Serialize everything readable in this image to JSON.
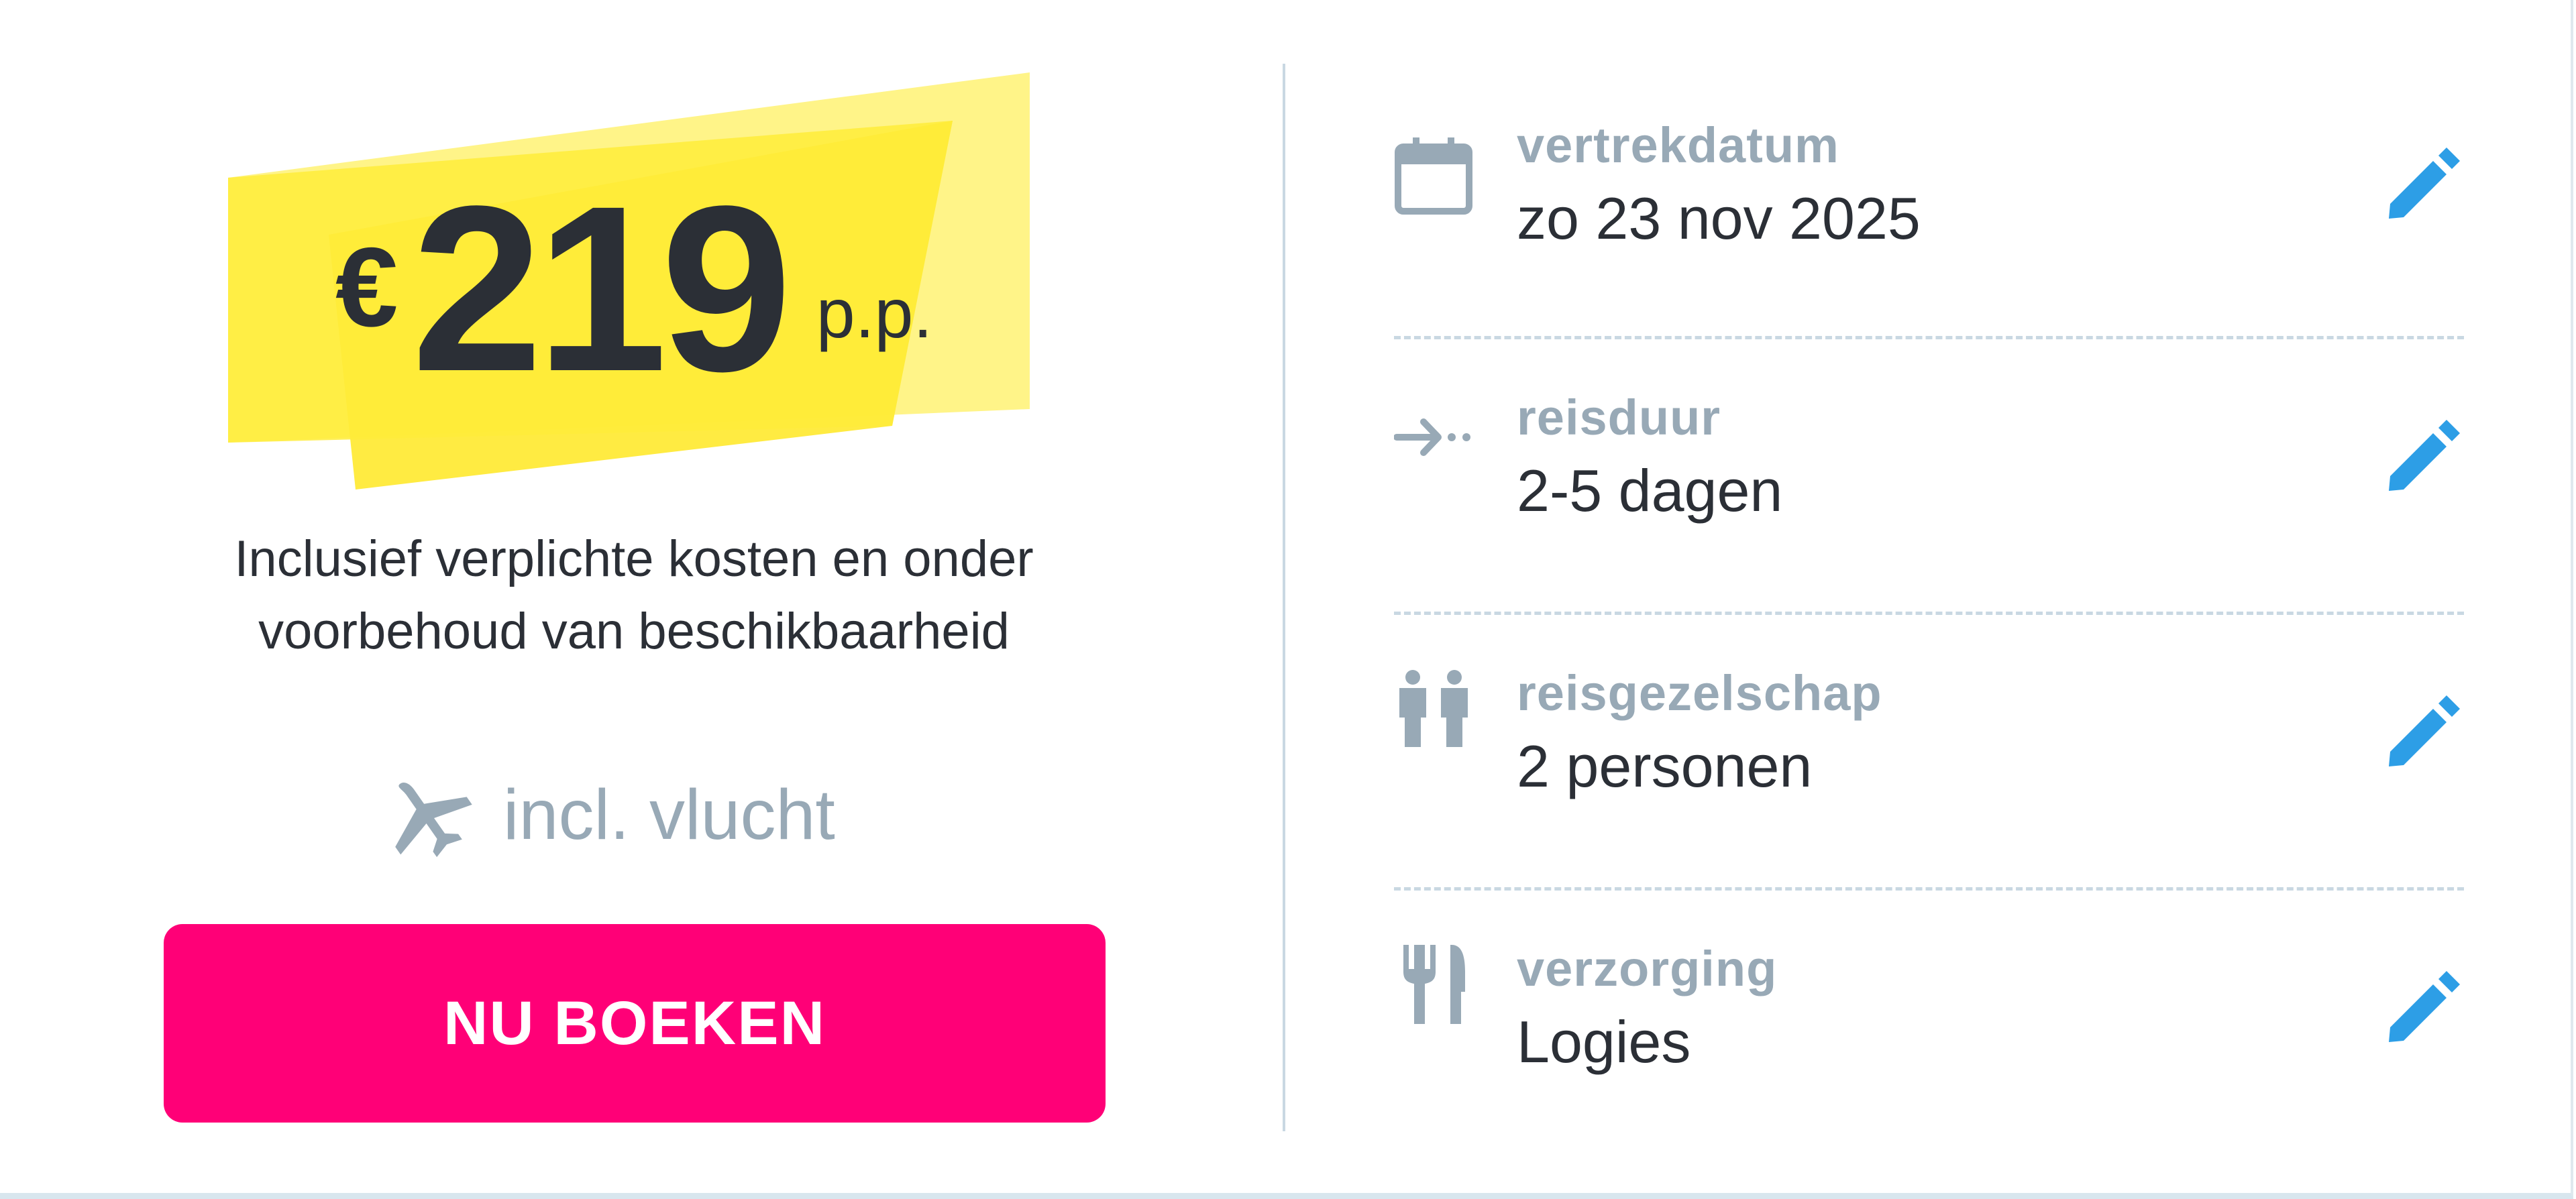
{
  "price": {
    "currency": "€",
    "amount": "219",
    "per_person": "p.p.",
    "note_line1": "Inclusief verplichte kosten en onder",
    "note_line2": "voorbehoud van beschikbaarheid"
  },
  "flight": {
    "label": "incl. vlucht",
    "icon": "plane-icon"
  },
  "cta": {
    "label": "NU BOEKEN"
  },
  "colors": {
    "highlight_yellow": "#ffe92e",
    "highlight_light": "#fff384",
    "cta_pink": "#ff0077",
    "edit_blue": "#2d9ee6",
    "muted_gray": "#98a9b6",
    "text_dark": "#2b2f36"
  },
  "details": [
    {
      "icon": "calendar-icon",
      "label": "vertrekdatum",
      "value": "zo 23 nov 2025",
      "edit_icon": "pencil-icon"
    },
    {
      "icon": "arrow-right-icon",
      "label": "reisduur",
      "value": "2-5 dagen",
      "edit_icon": "pencil-icon"
    },
    {
      "icon": "people-icon",
      "label": "reisgezelschap",
      "value": "2 personen",
      "edit_icon": "pencil-icon"
    },
    {
      "icon": "cutlery-icon",
      "label": "verzorging",
      "value": "Logies",
      "edit_icon": "pencil-icon"
    }
  ]
}
